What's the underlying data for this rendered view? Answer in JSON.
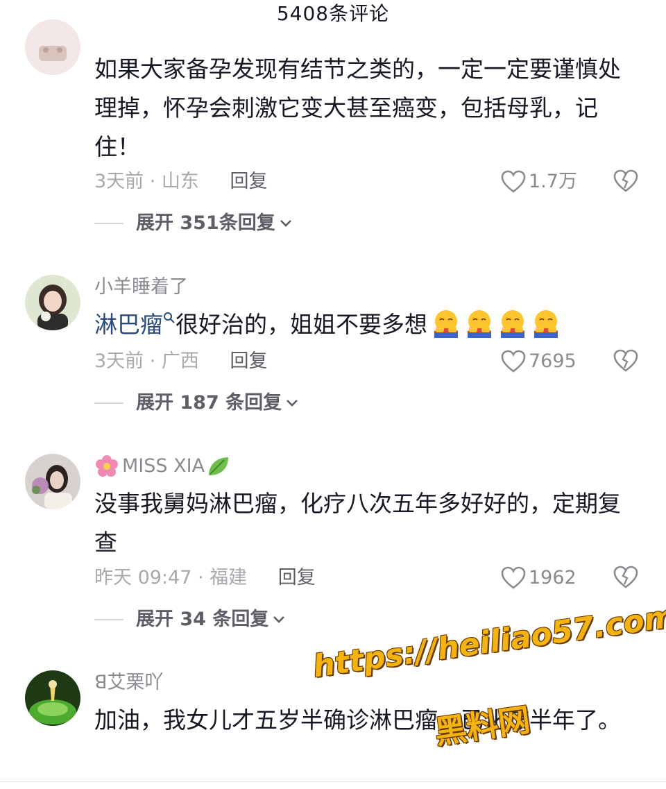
{
  "header": {
    "title": "5408条评论"
  },
  "comments": [
    {
      "username": "",
      "text": "如果大家备孕发现有结节之类的，一定一定要谨慎处理掉，怀孕会刺激它变大甚至癌变，包括母乳，记住！",
      "time_location": "3天前 · 山东",
      "reply_label": "回复",
      "likes": "1.7万",
      "expand_label": "展开 351条回复"
    },
    {
      "username": "小羊睡着了",
      "link_text": "淋巴瘤",
      "text": "很好治的，姐姐不要多想",
      "time_location": "3天前 · 广西",
      "reply_label": "回复",
      "likes": "7695",
      "expand_label": "展开 187 条回复"
    },
    {
      "username": "MISS XIA",
      "text": "没事我舅妈淋巴瘤，化疗八次五年多好好的，定期复查",
      "time_location": "昨天 09:47 · 福建",
      "reply_label": "回复",
      "likes": "1962",
      "expand_label": "展开 34 条回复"
    },
    {
      "username": "艾栗吖",
      "username_prefix": "ꓭ",
      "text": "加油，我女儿才五岁半确诊淋巴瘤，已化疗半年了。"
    }
  ],
  "watermark": {
    "url": "https://heiliao57.com",
    "brand": "黑料网"
  },
  "colors": {
    "accent_link": "#2a4a7c",
    "watermark": "#f3b313"
  }
}
